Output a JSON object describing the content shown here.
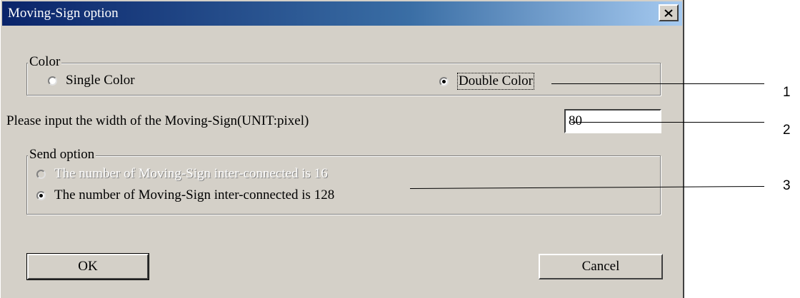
{
  "window": {
    "title": "Moving-Sign option"
  },
  "color_group": {
    "legend": "Color",
    "options": [
      {
        "label": "Single Color",
        "checked": false
      },
      {
        "label": "Double Color",
        "checked": true
      }
    ]
  },
  "width_field": {
    "label": "Please input the width of the Moving-Sign(UNIT:pixel)",
    "value": "80"
  },
  "send_group": {
    "legend": "Send option",
    "options": [
      {
        "label": "The number of Moving-Sign inter-connected is 16",
        "checked": false,
        "enabled": false
      },
      {
        "label": "The number of Moving-Sign inter-connected is 128",
        "checked": true,
        "enabled": true
      }
    ]
  },
  "buttons": {
    "ok": "OK",
    "cancel": "Cancel"
  },
  "callouts": [
    "1",
    "2",
    "3"
  ]
}
